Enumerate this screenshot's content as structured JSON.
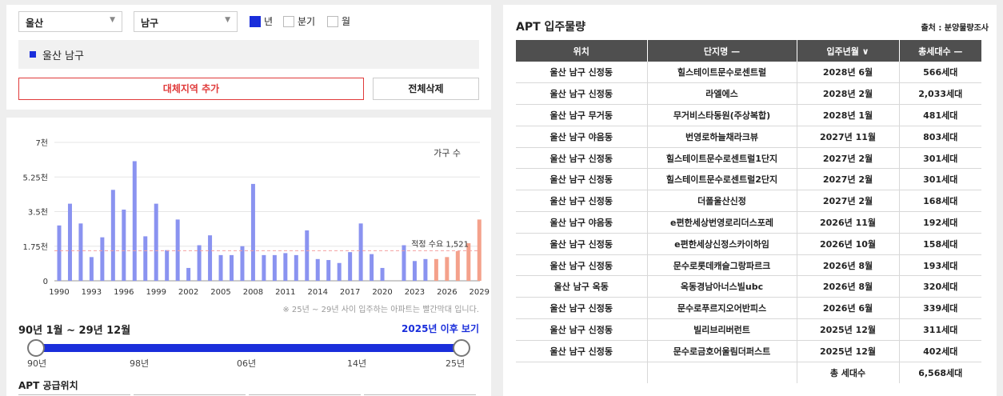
{
  "filters": {
    "city": "울산",
    "district": "남구",
    "period_year": "년",
    "period_quarter": "분기",
    "period_month": "월"
  },
  "region_chip": "울산 남구",
  "buttons": {
    "add_region": "대체지역 추가",
    "delete_all": "전체삭제"
  },
  "chart_data": {
    "type": "bar",
    "title": "",
    "legend": "가구 수",
    "y_tick_labels": [
      "0",
      "1.75천",
      "3.5천",
      "5.25천",
      "7천"
    ],
    "ylim": [
      0,
      7000
    ],
    "x_tick_labels": [
      "1990",
      "1993",
      "1996",
      "1999",
      "2002",
      "2005",
      "2008",
      "2011",
      "2014",
      "2017",
      "2020",
      "2023",
      "2026",
      "2029"
    ],
    "categories": [
      "1990",
      "1991",
      "1992",
      "1993",
      "1994",
      "1995",
      "1996",
      "1997",
      "1998",
      "1999",
      "2000",
      "2001",
      "2002",
      "2003",
      "2004",
      "2005",
      "2006",
      "2007",
      "2008",
      "2009",
      "2010",
      "2011",
      "2012",
      "2013",
      "2014",
      "2015",
      "2016",
      "2017",
      "2018",
      "2019",
      "2020",
      "2021",
      "2022",
      "2023",
      "2024",
      "2025",
      "2026",
      "2027",
      "2028",
      "2029"
    ],
    "values": [
      2800,
      3900,
      2900,
      1200,
      2200,
      4600,
      3600,
      6050,
      2250,
      3900,
      1550,
      3100,
      650,
      1800,
      2300,
      1300,
      1300,
      1750,
      4900,
      1300,
      1300,
      1400,
      1300,
      2550,
      1100,
      1050,
      900,
      1450,
      2900,
      1350,
      650,
      0,
      1800,
      1000,
      1100,
      1100,
      1200,
      1500,
      1900,
      3100
    ],
    "highlight_from": "2025",
    "colors": {
      "normal": "#8a93f0",
      "highlight": "#f4a18b",
      "reference": "#f4a0a0"
    },
    "reference_line": {
      "value": 1521,
      "label": "적정 수요 1,521"
    },
    "grid": true
  },
  "chart_note": "※ 25년 ~ 29년 사이 입주하는 아파트는 빨간막대 입니다.",
  "range": {
    "title": "90년 1월 ~ 29년 12월",
    "link": "2025년 이후 보기",
    "ticks": [
      "90년",
      "98년",
      "06년",
      "14년",
      "25년"
    ]
  },
  "supply_title": "APT 공급위치",
  "table": {
    "title": "APT 입주물량",
    "source": "출처 : 분양물량조사",
    "headers": [
      "위치",
      "단지명 —",
      "입주년월 ∨",
      "총세대수 —"
    ],
    "rows": [
      [
        "울산 남구 신정동",
        "힐스테이트문수로센트럴",
        "2028년 6월",
        "566세대"
      ],
      [
        "울산 남구 신정동",
        "라엘에스",
        "2028년 2월",
        "2,033세대"
      ],
      [
        "울산 남구 무거동",
        "무거비스타동원(주상복합)",
        "2028년 1월",
        "481세대"
      ],
      [
        "울산 남구 야음동",
        "번영로하늘채라크뷰",
        "2027년 11월",
        "803세대"
      ],
      [
        "울산 남구 신정동",
        "힐스테이트문수로센트럴1단지",
        "2027년 2월",
        "301세대"
      ],
      [
        "울산 남구 신정동",
        "힐스테이트문수로센트럴2단지",
        "2027년 2월",
        "301세대"
      ],
      [
        "울산 남구 신정동",
        "더폴울산신정",
        "2027년 2월",
        "168세대"
      ],
      [
        "울산 남구 야음동",
        "e편한세상번영로리더스포레",
        "2026년 11월",
        "192세대"
      ],
      [
        "울산 남구 신정동",
        "e편한세상신정스카이하임",
        "2026년 10월",
        "158세대"
      ],
      [
        "울산 남구 신정동",
        "문수로롯데캐슬그랑파르크",
        "2026년 8월",
        "193세대"
      ],
      [
        "울산 남구 옥동",
        "옥동경남아너스빌ubc",
        "2026년 8월",
        "320세대"
      ],
      [
        "울산 남구 신정동",
        "문수로푸르지오어반피스",
        "2026년 6월",
        "339세대"
      ],
      [
        "울산 남구 신정동",
        "빌리브리버런트",
        "2025년 12월",
        "311세대"
      ],
      [
        "울산 남구 신정동",
        "문수로금호어울림더퍼스트",
        "2025년 12월",
        "402세대"
      ]
    ],
    "total_label": "총 세대수",
    "total_value": "6,568세대"
  }
}
